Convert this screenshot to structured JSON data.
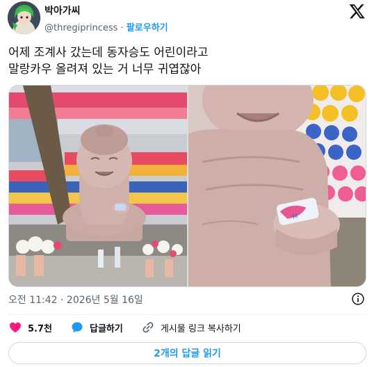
{
  "author": {
    "display_name": "박아가씨",
    "handle": "@thregiprincess",
    "separator": "·",
    "follow_label": "팔로우하기",
    "avatar_icon": "avatar-anime-girl"
  },
  "tweet": {
    "text": "어제 조계사 갔는데 동자승도 어린이라고\n말랑카우 올려져 있는 거 너무 귀엽잖아",
    "timestamp": "오전 11:42 · 2026년 5월 16일"
  },
  "actions": {
    "like_count": "5.7천",
    "reply_label": "답글하기",
    "copy_link_label": "게시물 링크 복사하기"
  },
  "replies_button": "2개의 답글 읽기",
  "colors": {
    "accent": "#1d9bf0",
    "like": "#f91880",
    "secondary_text": "#536471"
  }
}
